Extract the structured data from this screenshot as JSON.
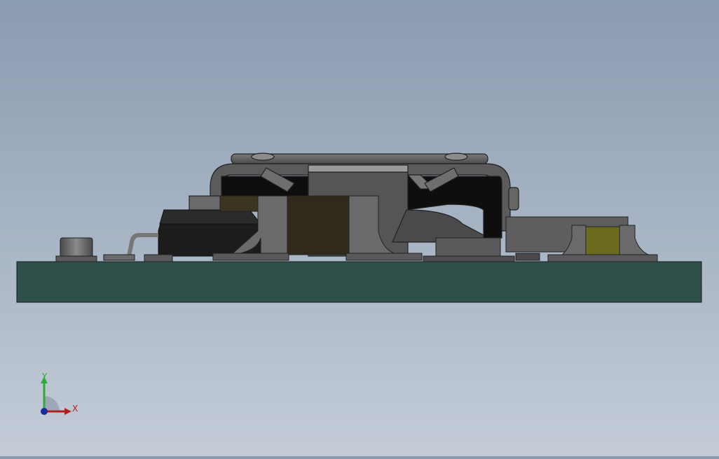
{
  "viewport": {
    "background_top": "#8a9bb0",
    "background_bottom": "#c4ccd8"
  },
  "model": {
    "board_color": "#2f4f4a",
    "component_dark": "#1c1c1c",
    "component_grey": "#5a5a5c",
    "component_brown": "#2f2a1c",
    "component_olive": "#6b6a1e"
  },
  "triad": {
    "y_label": "Y",
    "x_label": "X",
    "y_color": "#2eaa3a",
    "x_color": "#b02020",
    "z_color": "#1c2a9a"
  }
}
